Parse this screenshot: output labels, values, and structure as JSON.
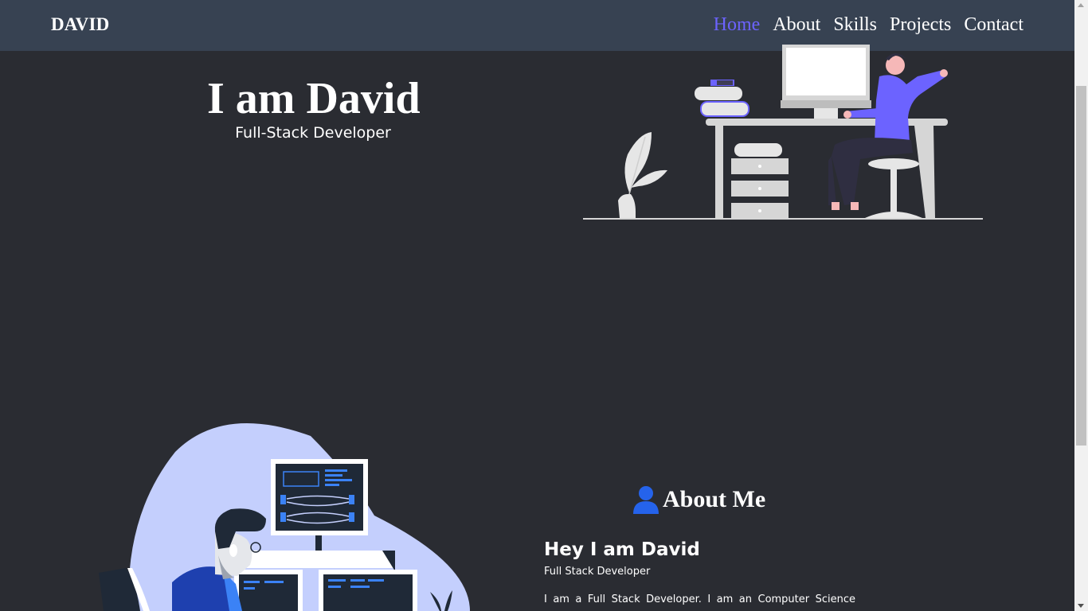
{
  "navbar": {
    "brand": "DAVID",
    "links": [
      "Home",
      "About",
      "Skills",
      "Projects",
      "Contact"
    ],
    "active": "Home",
    "active_color": "#6c63ff",
    "background": "#374252"
  },
  "hero": {
    "title": "I am David",
    "subtitle": "Full-Stack Developer",
    "illustration": "person-at-desk-illustration"
  },
  "about": {
    "heading": "About Me",
    "heading_icon": "user-icon",
    "name": "Hey I am David",
    "role": "Full Stack Developer",
    "text": "I am a Full Stack Developer. I am an Computer Science",
    "illustration": "developer-at-computer-illustration"
  },
  "colors": {
    "page_background": "#2a2c32",
    "accent": "#6c63ff",
    "icon_blue": "#2563eb"
  }
}
